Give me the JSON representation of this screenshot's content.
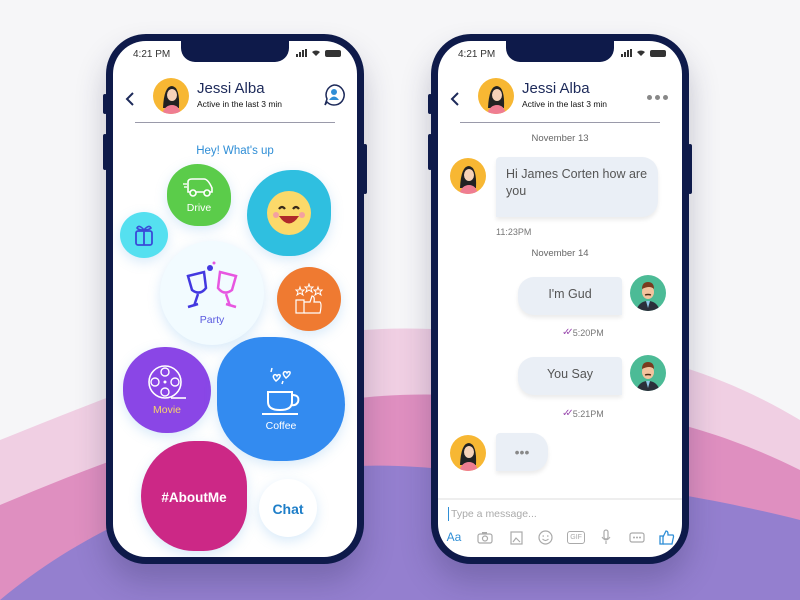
{
  "colors": {
    "phone_frame": "#0e1a4a",
    "accent_blue": "#2f8ed6",
    "drive": "#5bcc4a",
    "emoji_bg": "#2fbfe0",
    "gift_bg": "#55e0f0",
    "party_bg": "#f2fbff",
    "rating_bg": "#ef7a31",
    "movie_bg": "#8a46e6",
    "coffee_bg": "#338bf0",
    "aboutme_bg": "#cc2886",
    "chat_bg": "#ffffff",
    "bubble_bg": "#eaeff6",
    "read_check": "#9c4fb0"
  },
  "left_phone": {
    "status": {
      "time": "4:21 PM"
    },
    "header": {
      "name": "Jessi Alba",
      "status": "Active in the last 3 min",
      "back_icon": "chevron-left-icon",
      "action_icon": "profile-chat-icon"
    },
    "greeting": "Hey! What's up",
    "bubbles": [
      {
        "id": "drive",
        "label": "Drive",
        "icon": "car-icon"
      },
      {
        "id": "emoji",
        "label": "",
        "icon": "smiley-emoji-icon"
      },
      {
        "id": "gift",
        "label": "",
        "icon": "gift-icon"
      },
      {
        "id": "party",
        "label": "Party",
        "icon": "wine-glasses-icon"
      },
      {
        "id": "rating",
        "label": "",
        "icon": "thumbs-up-stars-icon"
      },
      {
        "id": "movie",
        "label": "Movie",
        "icon": "film-reel-icon"
      },
      {
        "id": "coffee",
        "label": "Coffee",
        "icon": "coffee-cup-icon"
      },
      {
        "id": "aboutme",
        "label": "#AboutMe",
        "icon": ""
      },
      {
        "id": "chat",
        "label": "Chat",
        "icon": ""
      }
    ]
  },
  "right_phone": {
    "status": {
      "time": "4:21 PM"
    },
    "header": {
      "name": "Jessi Alba",
      "status": "Active in the last 3 min",
      "back_icon": "chevron-left-icon",
      "action_icon": "more-dots-icon"
    },
    "messages": [
      {
        "type": "date",
        "text": "November 13"
      },
      {
        "type": "incoming",
        "text": "Hi James Corten how are you",
        "time": "11:23PM"
      },
      {
        "type": "date",
        "text": "November 14"
      },
      {
        "type": "outgoing",
        "text": "I'm Gud",
        "time": "5:20PM",
        "read": true
      },
      {
        "type": "outgoing",
        "text": "You Say",
        "time": "5:21PM",
        "read": true
      },
      {
        "type": "typing",
        "text": "•••"
      }
    ],
    "composer": {
      "placeholder": "Type a message...",
      "tools": [
        {
          "name": "text-format",
          "label": "Aa"
        },
        {
          "name": "camera",
          "label": ""
        },
        {
          "name": "gallery",
          "label": ""
        },
        {
          "name": "emoji",
          "label": ""
        },
        {
          "name": "gif",
          "label": "GIF"
        },
        {
          "name": "microphone",
          "label": ""
        },
        {
          "name": "more",
          "label": ""
        },
        {
          "name": "like",
          "label": ""
        }
      ]
    }
  }
}
